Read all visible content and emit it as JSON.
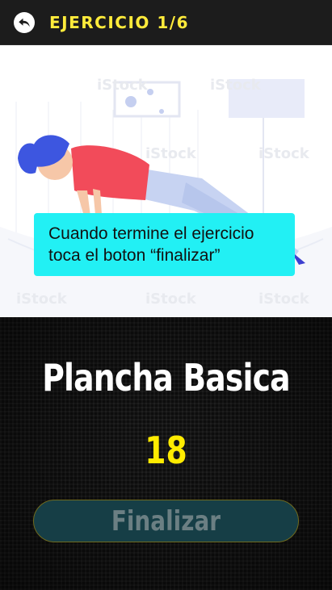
{
  "header": {
    "title": "EJERCICIO 1/6",
    "back_icon": "back-arrow-icon"
  },
  "illustration": {
    "watermark": "iStock by Getty Images"
  },
  "tip": {
    "line1": "Cuando termine el ejercicio",
    "line2": "toca el boton “finalizar”"
  },
  "exercise": {
    "name": "Plancha Basica",
    "count": "18"
  },
  "finish_button": {
    "label": "Finalizar"
  },
  "colors": {
    "accent_yellow": "#ffeb00",
    "tip_background": "#22f0f4",
    "button_background": "#163e46"
  }
}
